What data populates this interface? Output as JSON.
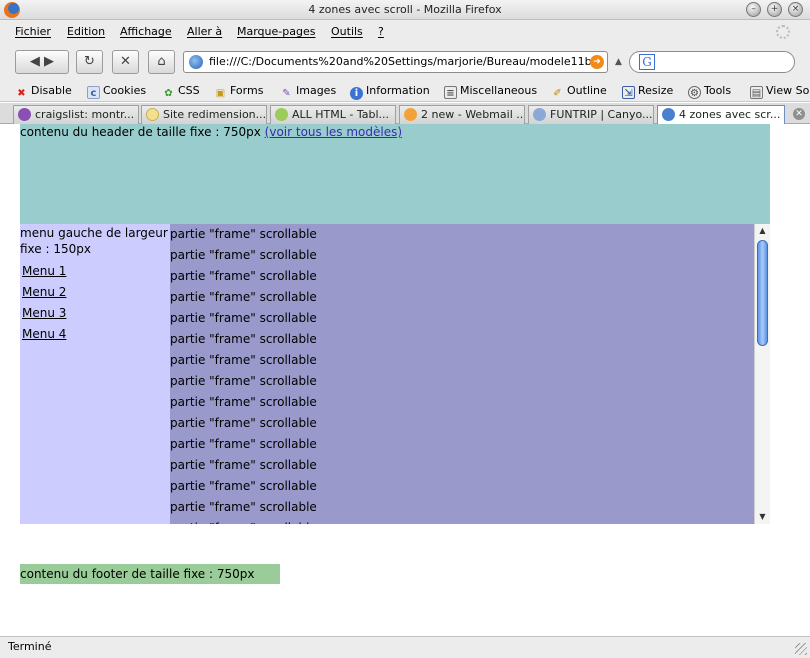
{
  "window": {
    "title": "4 zones avec scroll - Mozilla Firefox"
  },
  "menubar": {
    "items": [
      "Fichier",
      "Edition",
      "Affichage",
      "Aller à",
      "Marque-pages",
      "Outils",
      "?"
    ]
  },
  "navbar": {
    "url": "file:///C:/Documents%20and%20Settings/marjorie/Bureau/modele11b",
    "search_value": ""
  },
  "devbar": {
    "items": [
      "Disable",
      "Cookies",
      "CSS",
      "Forms",
      "Images",
      "Information",
      "Miscellaneous",
      "Outline",
      "Resize",
      "Tools",
      "View So"
    ]
  },
  "tabs": {
    "items": [
      "craigslist: montr...",
      "Site redimension...",
      "ALL HTML - Tabl...",
      "2 new - Webmail ...",
      "FUNTRIP | Canyo...",
      "4 zones avec scr..."
    ],
    "active_index": 5
  },
  "page": {
    "header_text": "contenu du header de taille fixe : 750px",
    "header_link": "(voir tous les modèles)",
    "menu_title": "menu gauche de largeur fixe : 150px",
    "menu_items": [
      "Menu 1",
      "Menu 2",
      "Menu 3",
      "Menu 4"
    ],
    "frame_line": "partie \"frame\" scrollable",
    "frame_line_count": 15,
    "footer_text": "contenu du footer de taille fixe : 750px"
  },
  "status": {
    "text": "Terminé"
  },
  "colors": {
    "header_bg": "#99cccc",
    "menu_bg": "#ccccff",
    "frame_bg": "#9999cc",
    "footer_bg": "#99cc99"
  }
}
